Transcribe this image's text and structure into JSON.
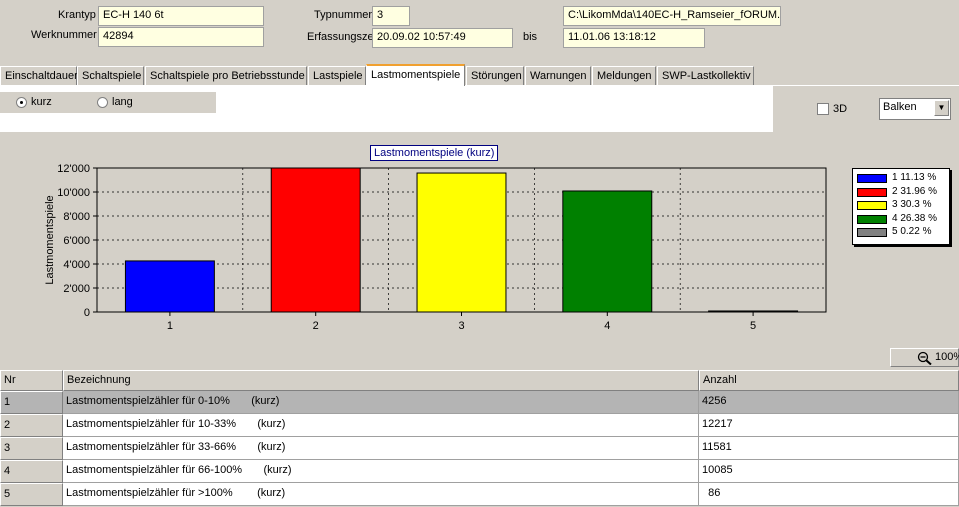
{
  "header": {
    "krantyp_label": "Krantyp",
    "krantyp_value": "EC-H 140 6t",
    "werknummer_label": "Werknummer",
    "werknummer_value": "42894",
    "typnummer_label": "Typnummer",
    "typnummer_value": "3",
    "erfassungszeit_label": "Erfassungszeit",
    "erfassungszeit_value": "20.09.02  10:57:49",
    "bis_label": "bis",
    "bis_value": "11.01.06  13:18:12",
    "path_value": "C:\\LikomMda\\140EC-H_Ramseier_fORUM."
  },
  "tabs": [
    {
      "label": "Einschaltdauer"
    },
    {
      "label": "Schaltspiele"
    },
    {
      "label": "Schaltspiele pro Betriebsstunde"
    },
    {
      "label": "Lastspiele"
    },
    {
      "label": "Lastmomentspiele"
    },
    {
      "label": "Störungen"
    },
    {
      "label": "Warnungen"
    },
    {
      "label": "Meldungen"
    },
    {
      "label": "SWP-Lastkollektiv"
    }
  ],
  "options": {
    "radio_kurz": "kurz",
    "radio_lang": "lang",
    "checkbox_3d": "3D",
    "chart_type_value": "Balken"
  },
  "chart_data": {
    "type": "bar",
    "title": "Lastmomentspiele (kurz)",
    "ylabel": "Lastmomentspiele",
    "xlabel": "",
    "categories": [
      "1",
      "2",
      "3",
      "4",
      "5"
    ],
    "values": [
      4256,
      12217,
      11581,
      10085,
      86
    ],
    "colors": [
      "#0000ff",
      "#ff0000",
      "#ffff00",
      "#008000",
      "#808080"
    ],
    "ylim": [
      0,
      12000
    ],
    "yticks": [
      "0",
      "2'000",
      "4'000",
      "6'000",
      "8'000",
      "10'000",
      "12'000"
    ],
    "ytick_values": [
      0,
      2000,
      4000,
      6000,
      8000,
      10000,
      12000
    ],
    "grid": true,
    "legend": [
      {
        "label": "1 11.13 %",
        "color": "#0000ff"
      },
      {
        "label": "2 31.96 %",
        "color": "#ff0000"
      },
      {
        "label": "3 30.3 %",
        "color": "#ffff00"
      },
      {
        "label": "4 26.38 %",
        "color": "#008000"
      },
      {
        "label": "5 0.22 %",
        "color": "#808080"
      }
    ],
    "legend_position": "right"
  },
  "table": {
    "zoom_label": "100%",
    "columns": [
      "Nr",
      "Bezeichnung",
      "Anzahl"
    ],
    "rows": [
      {
        "nr": "1",
        "bezeichnung": "Lastmomentspielzähler für 0-10%       (kurz)",
        "anzahl": "4256"
      },
      {
        "nr": "2",
        "bezeichnung": "Lastmomentspielzähler für 10-33%       (kurz)",
        "anzahl": "12217"
      },
      {
        "nr": "3",
        "bezeichnung": "Lastmomentspielzähler für 33-66%       (kurz)",
        "anzahl": "11581"
      },
      {
        "nr": "4",
        "bezeichnung": "Lastmomentspielzähler für 66-100%       (kurz)",
        "anzahl": "10085"
      },
      {
        "nr": "5",
        "bezeichnung": "Lastmomentspielzähler für >100%        (kurz)",
        "anzahl": "  86"
      }
    ]
  }
}
